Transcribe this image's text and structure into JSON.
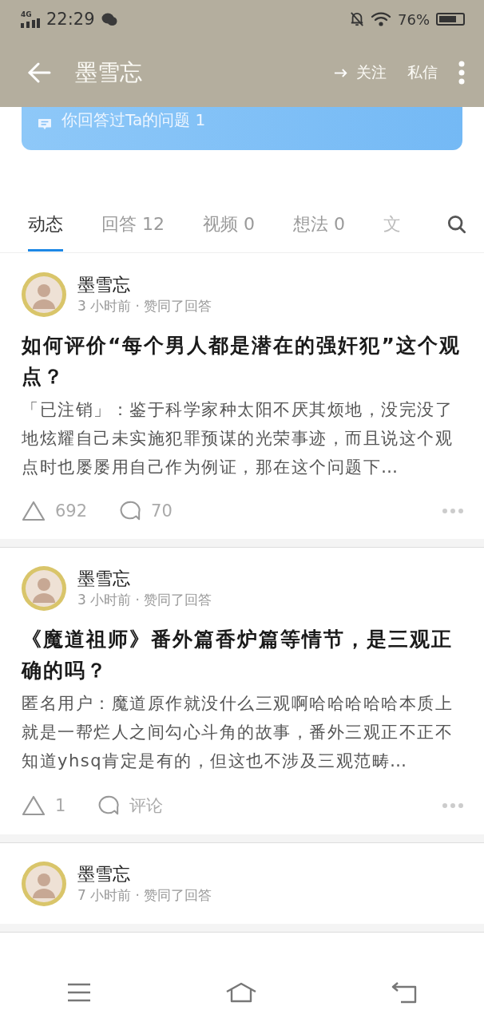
{
  "status_bar": {
    "network": "4G",
    "time": "22:29",
    "battery": "76%"
  },
  "app_bar": {
    "title": "墨雪忘",
    "actions": [
      {
        "label": "关注",
        "kind": "follow"
      },
      {
        "label": "私信",
        "kind": "plain"
      }
    ]
  },
  "banner": {
    "text": "你回答过Ta的问题 1"
  },
  "tabs": [
    {
      "label": "动态",
      "selected": true,
      "faded": false
    },
    {
      "label": "回答 12",
      "selected": false,
      "faded": false
    },
    {
      "label": "视频 0",
      "selected": false,
      "faded": false
    },
    {
      "label": "想法 0",
      "selected": false,
      "faded": false
    },
    {
      "label": "文",
      "selected": false,
      "faded": true
    }
  ],
  "feed": [
    {
      "author": "墨雪忘",
      "meta": "3 小时前 · 赞同了回答",
      "title": "如何评价“每个男人都是潜在的强奸犯”这个观点？",
      "excerpt": "「已注销」：鉴于科学家种太阳不厌其烦地，没完没了地炫耀自己未实施犯罪预谋的光荣事迹，而且说这个观点时也屡屡用自己作为例证，那在这个问题下…",
      "votes": "692",
      "comments": "70"
    },
    {
      "author": "墨雪忘",
      "meta": "3 小时前 · 赞同了回答",
      "title": "《魔道祖师》番外篇香炉篇等情节，是三观正确的吗？",
      "excerpt": "匿名用户：魔道原作就没什么三观啊哈哈哈哈哈本质上就是一帮烂人之间勾心斗角的故事，番外三观正不正不知道yhsq肯定是有的，但这也不涉及三观范畴…",
      "votes": "1",
      "comments": "评论"
    },
    {
      "author": "墨雪忘",
      "meta": "7 小时前 · 赞同了回答"
    }
  ]
}
